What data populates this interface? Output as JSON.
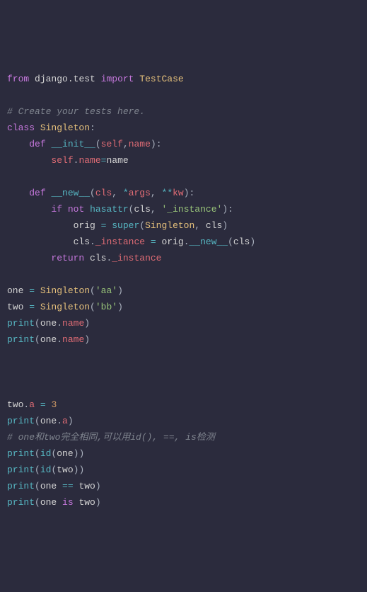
{
  "code": {
    "l0": {
      "from": "from",
      "mod": "django",
      "test": ".test",
      "imp": "import",
      "cls": "TestCase"
    },
    "l1": "",
    "l2": "# Create your tests here.",
    "l3": {
      "class": "class",
      "name": "Singleton",
      "colon": ":"
    },
    "l4": {
      "indent": "    ",
      "def": "def",
      "name": "__init__",
      "p1": "(",
      "self": "self",
      "comma": ",",
      "arg": "name",
      "p2": ")",
      "colon": ":"
    },
    "l5": {
      "indent": "        ",
      "self": "self",
      "dot": ".",
      "attr": "name",
      "eq": "=",
      "val": "name"
    },
    "l6": "",
    "l7": {
      "indent": "    ",
      "def": "def",
      "name": "__new__",
      "p1": "(",
      "cls": "cls",
      "c1": ", ",
      "star": "*",
      "args": "args",
      "c2": ", ",
      "dstar": "**",
      "kw": "kw",
      "p2": ")",
      "colon": ":"
    },
    "l8": {
      "indent": "        ",
      "if": "if",
      "not": "not",
      "hasattr": "hasattr",
      "p1": "(",
      "cls": "cls",
      "c": ", ",
      "str": "'_instance'",
      "p2": ")",
      "colon": ":"
    },
    "l9": {
      "indent": "            ",
      "orig": "orig ",
      "eq": "=",
      "super": " super",
      "p1": "(",
      "sing": "Singleton",
      "c": ", ",
      "cls": "cls",
      "p2": ")"
    },
    "l10": {
      "indent": "            ",
      "cls": "cls",
      "dot1": ".",
      "inst": "_instance ",
      "eq": "=",
      "orig": " orig",
      "dot2": ".",
      "new": "__new__",
      "p1": "(",
      "cls2": "cls",
      "p2": ")"
    },
    "l11": {
      "indent": "        ",
      "ret": "return",
      "cls": " cls",
      "dot": ".",
      "inst": "_instance"
    },
    "l12": "",
    "l13": {
      "one": "one ",
      "eq": "=",
      "sing": " Singleton",
      "p1": "(",
      "str": "'aa'",
      "p2": ")"
    },
    "l14": {
      "two": "two ",
      "eq": "=",
      "sing": " Singleton",
      "p1": "(",
      "str": "'bb'",
      "p2": ")"
    },
    "l15": {
      "print": "print",
      "p1": "(",
      "one": "one",
      "dot": ".",
      "name": "name",
      "p2": ")"
    },
    "l16": {
      "print": "print",
      "p1": "(",
      "one": "one",
      "dot": ".",
      "name": "name",
      "p2": ")"
    },
    "l17": "",
    "l18": "",
    "l19": "",
    "l20": {
      "two": "two",
      "dot": ".",
      "a": "a ",
      "eq": "=",
      "num": " 3"
    },
    "l21": {
      "print": "print",
      "p1": "(",
      "one": "one",
      "dot": ".",
      "a": "a",
      "p2": ")"
    },
    "l22": "# one和two完全相同,可以用id(), ==, is检测",
    "l23": {
      "print": "print",
      "p1": "(",
      "id": "id",
      "p2": "(",
      "one": "one",
      "p3": ")",
      "p4": ")"
    },
    "l24": {
      "print": "print",
      "p1": "(",
      "id": "id",
      "p2": "(",
      "two": "two",
      "p3": ")",
      "p4": ")"
    },
    "l25": {
      "print": "print",
      "p1": "(",
      "one": "one ",
      "eq": "==",
      "two": " two",
      "p2": ")"
    },
    "l26": {
      "print": "print",
      "p1": "(",
      "one": "one ",
      "is": "is",
      "two": " two",
      "p2": ")"
    }
  }
}
